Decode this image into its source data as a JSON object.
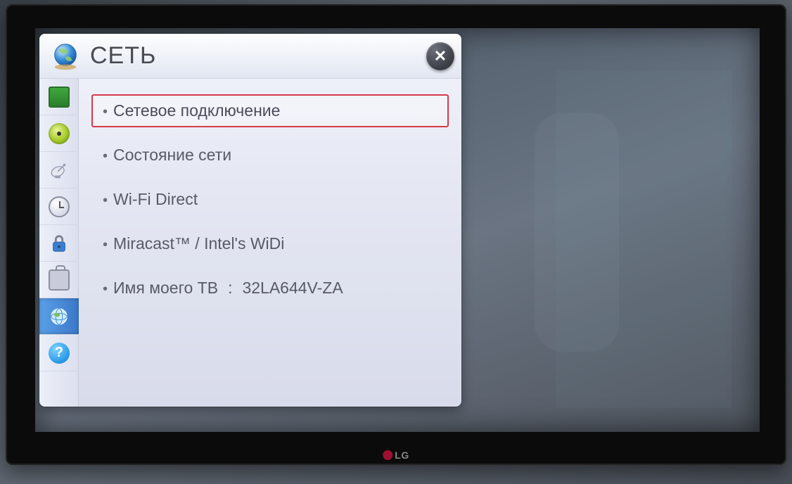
{
  "header": {
    "title": "СЕТЬ",
    "close_symbol": "✕"
  },
  "sidebar": {
    "items": [
      {
        "name": "picture",
        "icon": "tv-icon"
      },
      {
        "name": "audio",
        "icon": "disc-icon"
      },
      {
        "name": "channel",
        "icon": "satellite-icon"
      },
      {
        "name": "time",
        "icon": "clock-icon"
      },
      {
        "name": "lock",
        "icon": "lock-icon"
      },
      {
        "name": "option",
        "icon": "briefcase-icon"
      },
      {
        "name": "network",
        "icon": "globe-icon",
        "active": true
      },
      {
        "name": "support",
        "icon": "help-icon"
      }
    ]
  },
  "menu": {
    "items": [
      {
        "label": "Сетевое подключение",
        "selected": true
      },
      {
        "label": "Состояние сети"
      },
      {
        "label": "Wi-Fi Direct"
      },
      {
        "label": "Miracast™ / Intel's WiDi"
      },
      {
        "label": "Имя моего ТВ",
        "value": "32LA644V-ZA"
      }
    ]
  },
  "tv": {
    "brand": "LG"
  }
}
